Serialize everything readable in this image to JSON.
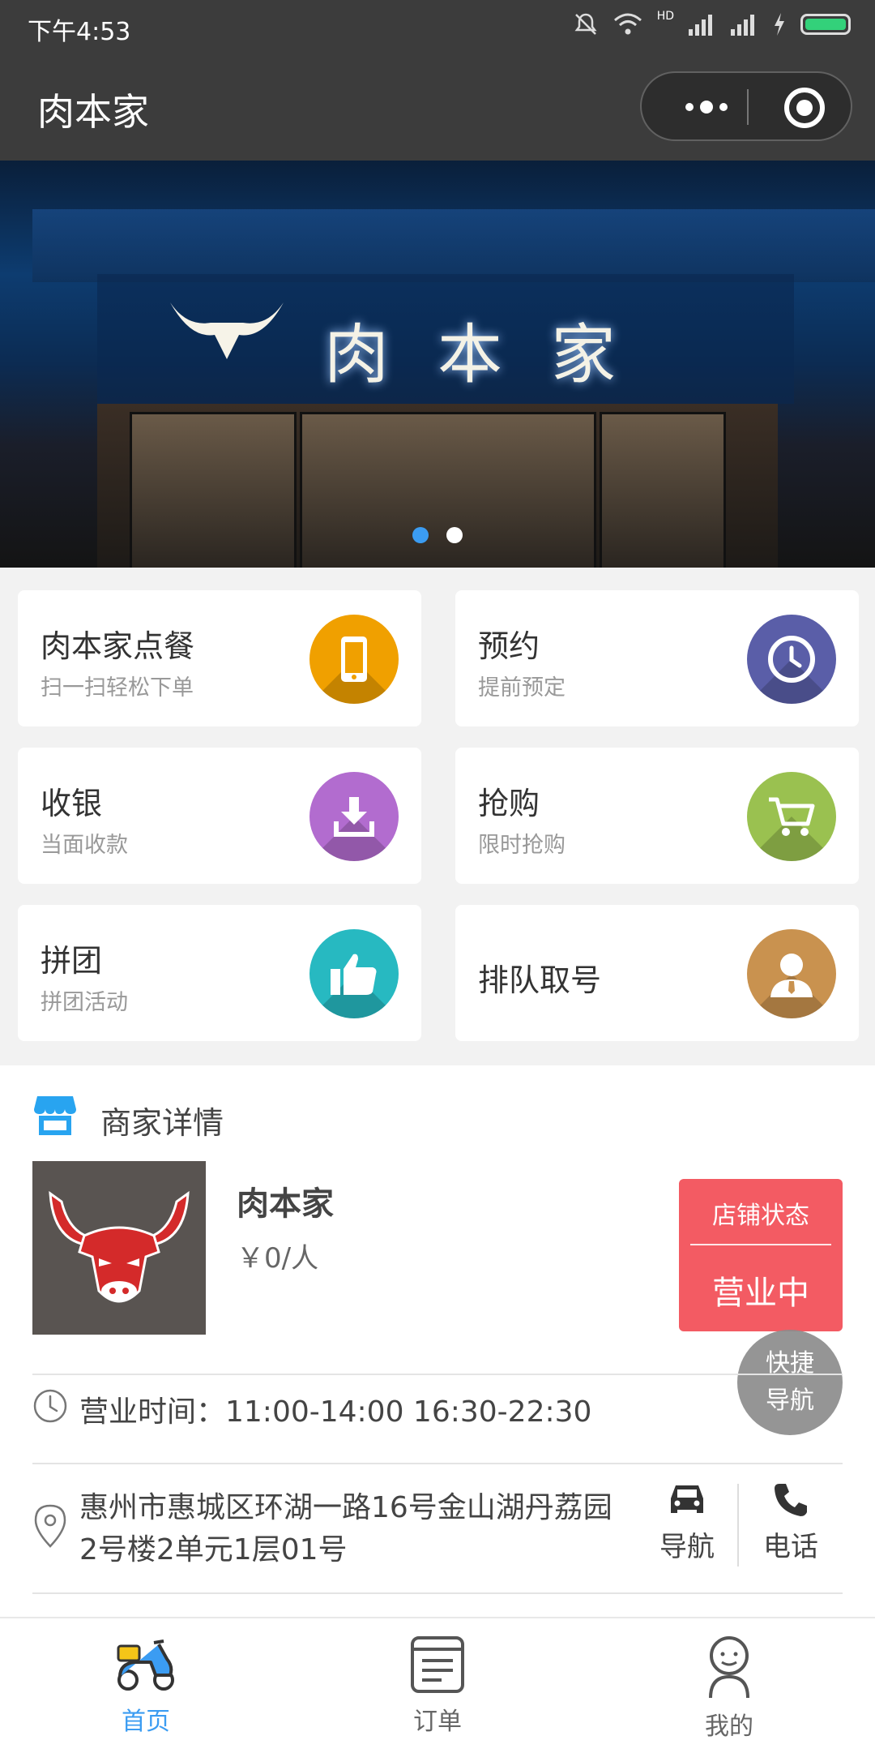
{
  "status_bar": {
    "time": "下午4:53",
    "network": "HD"
  },
  "nav": {
    "title": "肉本家"
  },
  "banner": {
    "sign_text": "肉本家",
    "slides": 2,
    "active_slide": 1
  },
  "features": [
    {
      "title": "肉本家点餐",
      "subtitle": "扫一扫轻松下单",
      "icon": "phone-icon",
      "color": "#f0a000"
    },
    {
      "title": "预约",
      "subtitle": "提前预定",
      "icon": "clock-icon",
      "color": "#5a5ea8"
    },
    {
      "title": "收银",
      "subtitle": "当面收款",
      "icon": "download-icon",
      "color": "#b26ccf"
    },
    {
      "title": "抢购",
      "subtitle": "限时抢购",
      "icon": "cart-icon",
      "color": "#9ac150"
    },
    {
      "title": "拼团",
      "subtitle": "拼团活动",
      "icon": "thumbs-up-icon",
      "color": "#27b9c1"
    },
    {
      "title": "排队取号",
      "subtitle": "",
      "icon": "person-icon",
      "color": "#c9924f"
    }
  ],
  "merchant": {
    "section_title": "商家详情",
    "name": "肉本家",
    "price": "￥0/人",
    "status_label": "店铺状态",
    "status_value": "营业中",
    "quick_nav_line1": "快捷",
    "quick_nav_line2": "导航",
    "hours": "营业时间：11:00-14:00   16:30-22:30",
    "address": "惠州市惠城区环湖一路16号金山湖丹荔园2号楼2单元1层01号",
    "nav_label": "导航",
    "phone_label": "电话"
  },
  "tabbar": [
    {
      "label": "首页",
      "active": true
    },
    {
      "label": "订单",
      "active": false
    },
    {
      "label": "我的",
      "active": false
    }
  ],
  "colors": {
    "accent": "#3b9cf2",
    "status_red": "#f35b63",
    "header": "#3c3c3c"
  }
}
